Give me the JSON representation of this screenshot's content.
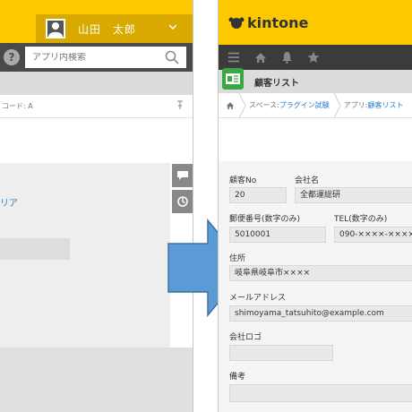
{
  "left_screen": {
    "user": {
      "name": "山田　太郎"
    },
    "search": {
      "placeholder": "アプリ内検索"
    },
    "breadcrumb_fragment": "コード: A",
    "link_fragment": "リア",
    "help_glyph": "?"
  },
  "right_screen": {
    "logo": "kintone",
    "app": {
      "title": "顧客リスト"
    },
    "breadcrumbs": {
      "space_label": "スペース: ",
      "space_value": "プラグイン試験",
      "app_label": "アプリ: ",
      "app_value": "顧客リスト"
    },
    "form": {
      "customer_no": {
        "label": "顧客No",
        "value": "20"
      },
      "company_name": {
        "label": "会社名",
        "value": "全都運総研"
      },
      "postal_code": {
        "label": "郵便番号(数字のみ)",
        "value": "5010001"
      },
      "tel": {
        "label": "TEL(数字のみ)",
        "value": "090-××××-××××"
      },
      "address": {
        "label": "住所",
        "value": "岐阜県岐阜市××××"
      },
      "email": {
        "label": "メールアドレス",
        "value": "shimoyama_tatsuhito@example.com"
      },
      "company_logo": {
        "label": "会社ロゴ",
        "value": ""
      },
      "remarks": {
        "label": "備考",
        "value": ""
      }
    }
  },
  "colors": {
    "kintone_yellow": "#fcc800",
    "header_dark_yellow": "#d9a900",
    "nav_dark": "#3b3b3b",
    "app_icon_green": "#3aa745",
    "arrow_blue": "#5b9bd5",
    "link_blue": "#2a7bd0"
  },
  "icons": [
    "user-icon",
    "chevron-down-icon",
    "help-icon",
    "search-icon",
    "pin-icon",
    "comment-icon",
    "refresh-icon",
    "menu-icon",
    "home-icon",
    "bell-icon",
    "star-icon",
    "app-icon",
    "arrow-icon"
  ]
}
